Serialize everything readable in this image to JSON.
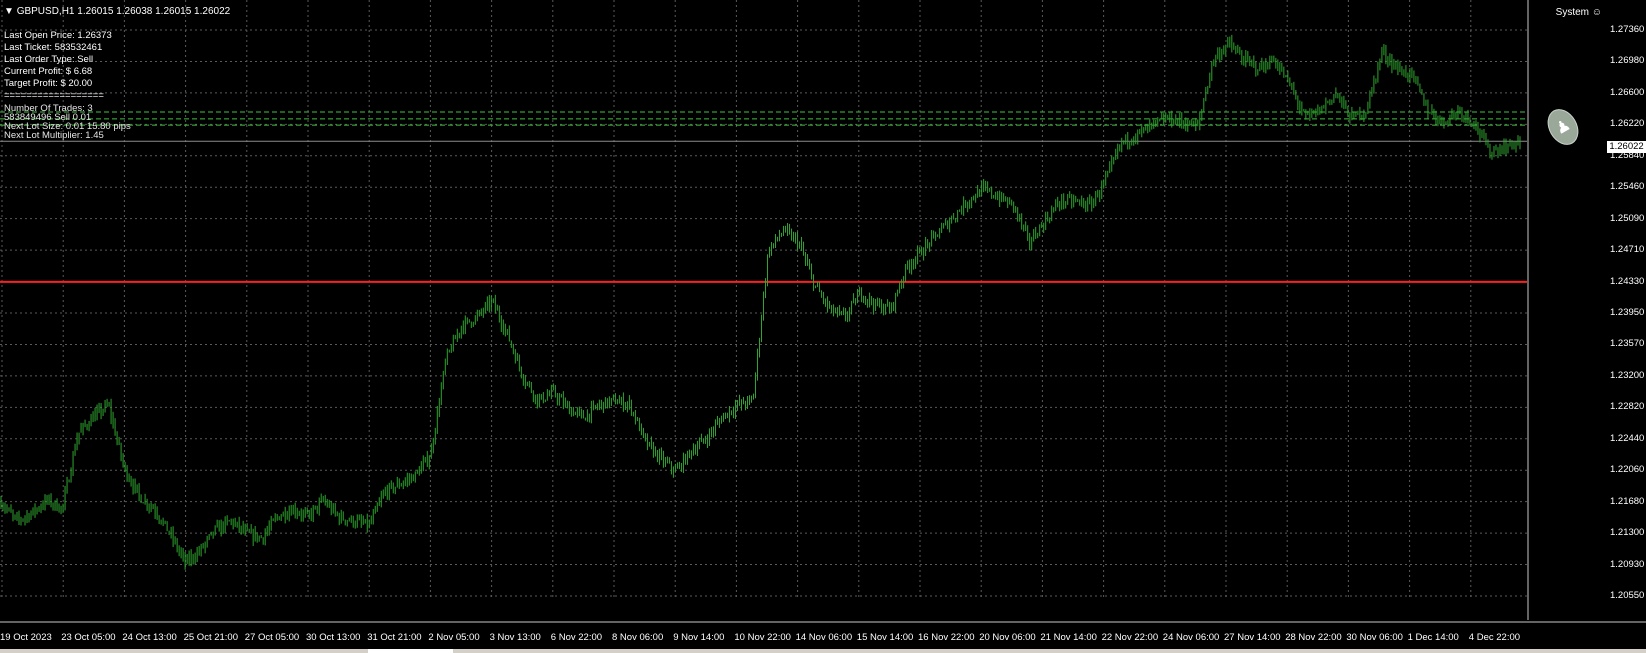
{
  "header": {
    "symbol": "GBPUSD,H1",
    "ohlc": "1.26015 1.26038 1.26015 1.26022",
    "system_label": "System"
  },
  "info_panel": [
    "Last Open Price: 1.26373",
    "Last Ticket: 583532461",
    "Last Order Type: Sell",
    "Current Profit: $ 6.68",
    "Target Profit: $ 20.00",
    "=================="
  ],
  "overlay_panel": [
    "Number Of Trades: 3",
    "583849496 Sell 0.01",
    "Next Lot Size: 0.01 15.80 pips",
    "Next Lot Multiplier: 1.45"
  ],
  "price_axis": [
    "1.27360",
    "1.26980",
    "1.26600",
    "1.26220",
    "1.25840",
    "1.25460",
    "1.25090",
    "1.24710",
    "1.24330",
    "1.23950",
    "1.23570",
    "1.23200",
    "1.22820",
    "1.22440",
    "1.22060",
    "1.21680",
    "1.21300",
    "1.20930",
    "1.20550"
  ],
  "current_price": "1.26022",
  "time_axis": [
    "19 Oct 2023",
    "23 Oct 05:00",
    "24 Oct 13:00",
    "25 Oct 21:00",
    "27 Oct 05:00",
    "30 Oct 13:00",
    "31 Oct 21:00",
    "2 Nov 05:00",
    "3 Nov 13:00",
    "6 Nov 22:00",
    "8 Nov 06:00",
    "9 Nov 14:00",
    "10 Nov 22:00",
    "14 Nov 06:00",
    "15 Nov 14:00",
    "16 Nov 22:00",
    "20 Nov 06:00",
    "21 Nov 14:00",
    "22 Nov 22:00",
    "24 Nov 06:00",
    "27 Nov 14:00",
    "28 Nov 22:00",
    "30 Nov 06:00",
    "1 Dec 14:00",
    "4 Dec 22:00"
  ],
  "chart_data": {
    "type": "bar",
    "price_range": [
      1.2055,
      1.2736
    ],
    "red_line_price": 1.2433,
    "dashed_levels": [
      1.26373,
      1.2629,
      1.26215
    ],
    "close_path": [
      {
        "t": 0,
        "p": 1.2168
      },
      {
        "t": 1,
        "p": 1.2145
      },
      {
        "t": 2,
        "p": 1.2155
      },
      {
        "t": 3,
        "p": 1.217
      },
      {
        "t": 4,
        "p": 1.216
      },
      {
        "t": 5,
        "p": 1.225
      },
      {
        "t": 6,
        "p": 1.227
      },
      {
        "t": 7,
        "p": 1.2285
      },
      {
        "t": 8,
        "p": 1.221
      },
      {
        "t": 9,
        "p": 1.2175
      },
      {
        "t": 10,
        "p": 1.216
      },
      {
        "t": 11,
        "p": 1.213
      },
      {
        "t": 12,
        "p": 1.2095
      },
      {
        "t": 13,
        "p": 1.211
      },
      {
        "t": 14,
        "p": 1.2135
      },
      {
        "t": 15,
        "p": 1.2145
      },
      {
        "t": 16,
        "p": 1.213
      },
      {
        "t": 17,
        "p": 1.2125
      },
      {
        "t": 18,
        "p": 1.215
      },
      {
        "t": 19,
        "p": 1.216
      },
      {
        "t": 20,
        "p": 1.215
      },
      {
        "t": 21,
        "p": 1.217
      },
      {
        "t": 22,
        "p": 1.215
      },
      {
        "t": 23,
        "p": 1.2145
      },
      {
        "t": 24,
        "p": 1.214
      },
      {
        "t": 25,
        "p": 1.218
      },
      {
        "t": 26,
        "p": 1.219
      },
      {
        "t": 27,
        "p": 1.22
      },
      {
        "t": 28,
        "p": 1.2225
      },
      {
        "t": 29,
        "p": 1.234
      },
      {
        "t": 30,
        "p": 1.238
      },
      {
        "t": 31,
        "p": 1.239
      },
      {
        "t": 32,
        "p": 1.241
      },
      {
        "t": 33,
        "p": 1.237
      },
      {
        "t": 34,
        "p": 1.232
      },
      {
        "t": 35,
        "p": 1.229
      },
      {
        "t": 36,
        "p": 1.23
      },
      {
        "t": 37,
        "p": 1.228
      },
      {
        "t": 38,
        "p": 1.227
      },
      {
        "t": 39,
        "p": 1.2285
      },
      {
        "t": 40,
        "p": 1.229
      },
      {
        "t": 41,
        "p": 1.2285
      },
      {
        "t": 42,
        "p": 1.224
      },
      {
        "t": 43,
        "p": 1.222
      },
      {
        "t": 44,
        "p": 1.2205
      },
      {
        "t": 45,
        "p": 1.223
      },
      {
        "t": 46,
        "p": 1.2245
      },
      {
        "t": 47,
        "p": 1.227
      },
      {
        "t": 48,
        "p": 1.2285
      },
      {
        "t": 49,
        "p": 1.229
      },
      {
        "t": 50,
        "p": 1.247
      },
      {
        "t": 51,
        "p": 1.2495
      },
      {
        "t": 52,
        "p": 1.248
      },
      {
        "t": 53,
        "p": 1.243
      },
      {
        "t": 54,
        "p": 1.24
      },
      {
        "t": 55,
        "p": 1.239
      },
      {
        "t": 56,
        "p": 1.242
      },
      {
        "t": 57,
        "p": 1.2405
      },
      {
        "t": 58,
        "p": 1.24
      },
      {
        "t": 59,
        "p": 1.245
      },
      {
        "t": 60,
        "p": 1.247
      },
      {
        "t": 61,
        "p": 1.249
      },
      {
        "t": 62,
        "p": 1.251
      },
      {
        "t": 63,
        "p": 1.253
      },
      {
        "t": 64,
        "p": 1.2545
      },
      {
        "t": 65,
        "p": 1.2535
      },
      {
        "t": 66,
        "p": 1.2525
      },
      {
        "t": 67,
        "p": 1.248
      },
      {
        "t": 68,
        "p": 1.2505
      },
      {
        "t": 69,
        "p": 1.253
      },
      {
        "t": 70,
        "p": 1.253
      },
      {
        "t": 71,
        "p": 1.2525
      },
      {
        "t": 72,
        "p": 1.2555
      },
      {
        "t": 73,
        "p": 1.26
      },
      {
        "t": 74,
        "p": 1.261
      },
      {
        "t": 75,
        "p": 1.262
      },
      {
        "t": 76,
        "p": 1.263
      },
      {
        "t": 77,
        "p": 1.2625
      },
      {
        "t": 78,
        "p": 1.262
      },
      {
        "t": 79,
        "p": 1.27
      },
      {
        "t": 80,
        "p": 1.272
      },
      {
        "t": 81,
        "p": 1.27
      },
      {
        "t": 82,
        "p": 1.269
      },
      {
        "t": 83,
        "p": 1.27
      },
      {
        "t": 84,
        "p": 1.267
      },
      {
        "t": 85,
        "p": 1.263
      },
      {
        "t": 86,
        "p": 1.264
      },
      {
        "t": 87,
        "p": 1.266
      },
      {
        "t": 88,
        "p": 1.263
      },
      {
        "t": 89,
        "p": 1.264
      },
      {
        "t": 90,
        "p": 1.271
      },
      {
        "t": 91,
        "p": 1.269
      },
      {
        "t": 92,
        "p": 1.268
      },
      {
        "t": 93,
        "p": 1.264
      },
      {
        "t": 94,
        "p": 1.2625
      },
      {
        "t": 95,
        "p": 1.264
      },
      {
        "t": 96,
        "p": 1.2625
      },
      {
        "t": 97,
        "p": 1.259
      },
      {
        "t": 98,
        "p": 1.2595
      },
      {
        "t": 99,
        "p": 1.2602
      }
    ],
    "colors": {
      "bar": "#2fa52f",
      "grid": "#5a5a5a",
      "red_line": "#ff1e1e",
      "dashed": "#3fbf3f",
      "axis_line": "#c8c8c8"
    }
  }
}
